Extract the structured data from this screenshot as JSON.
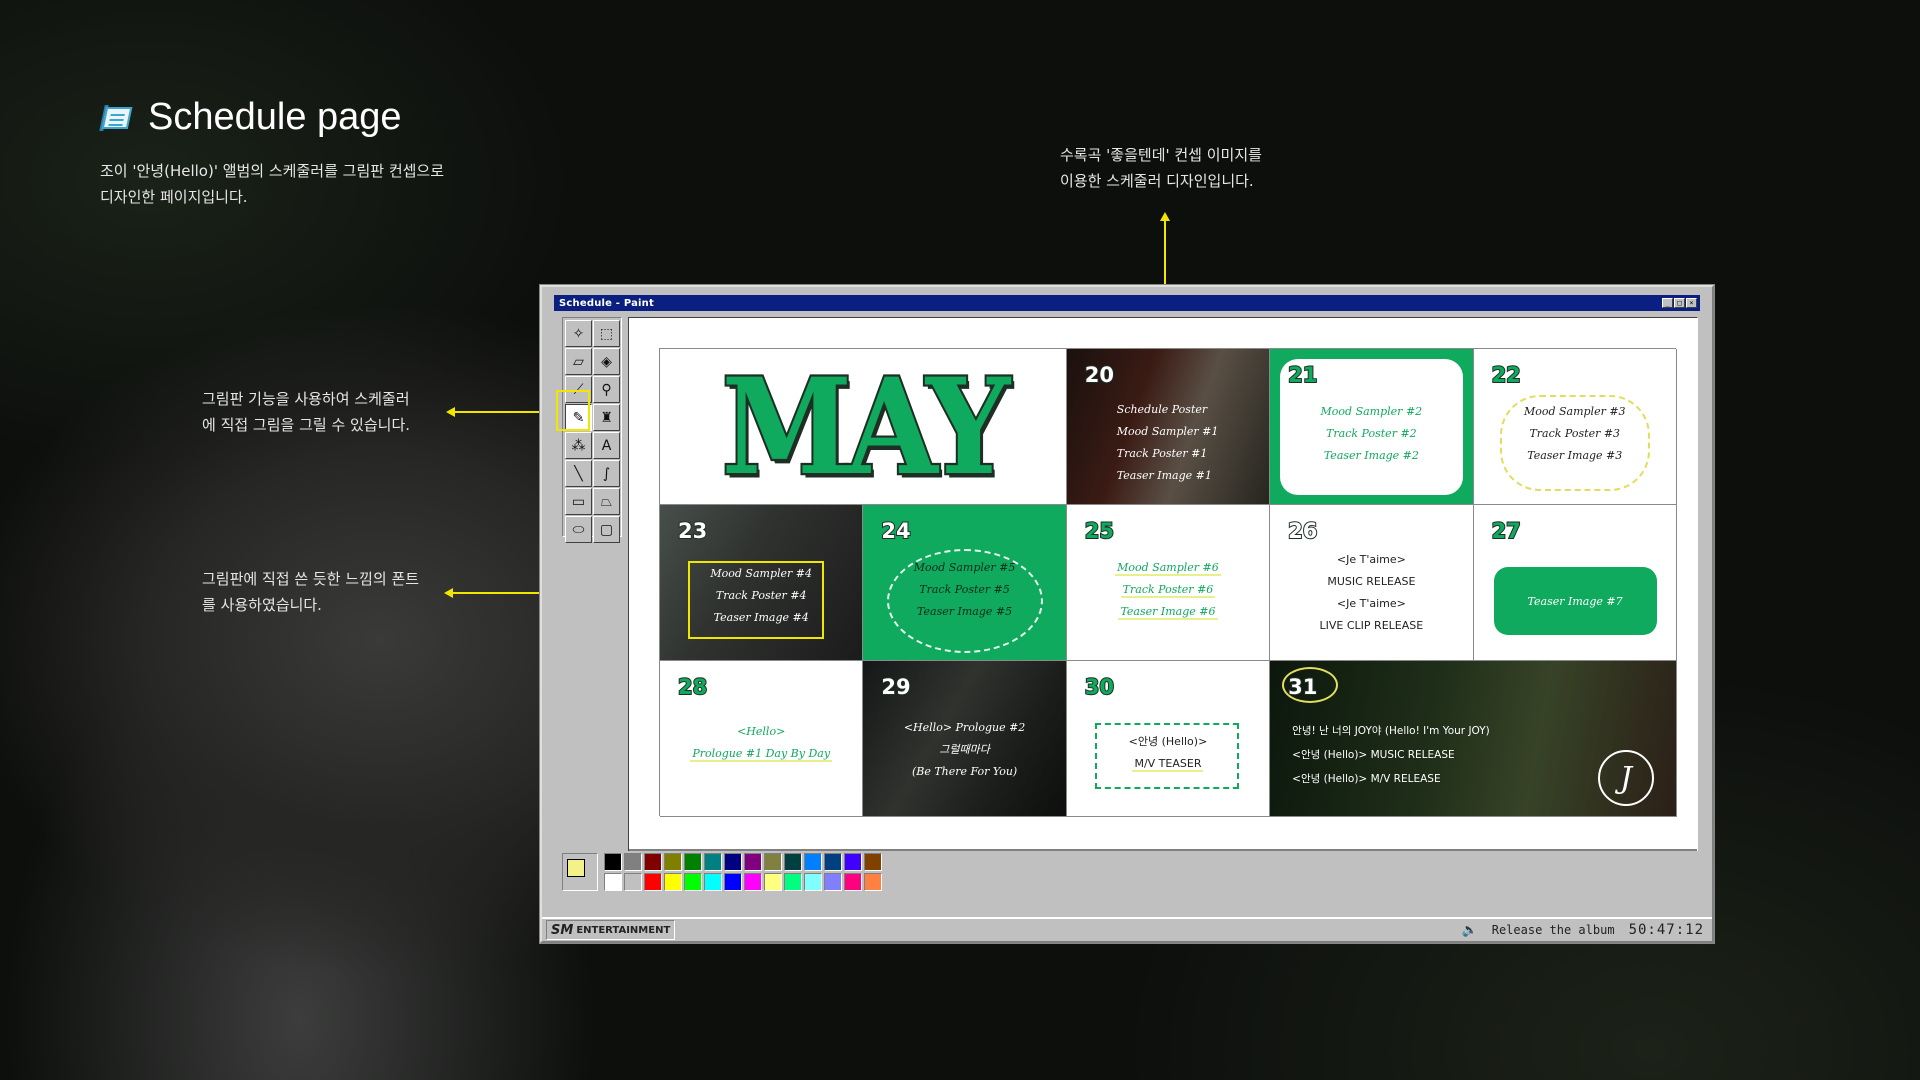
{
  "page": {
    "title": "Schedule page",
    "description_line1": "조이 '안녕(Hello)' 앨범의 스케줄러를 그림판 컨셉으로",
    "description_line2": "디자인한 페이지입니다."
  },
  "annotations": {
    "top_line1": "수록곡 '좋을텐데' 컨셉 이미지를",
    "top_line2": "이용한 스케줄러 디자인입니다.",
    "tool_line1": "그림판 기능을 사용하여 스케줄러",
    "tool_line2": "에 직접 그림을 그릴 수 있습니다.",
    "font_line1": "그림판에 직접 쓴 듯한 느낌의 폰트",
    "font_line2": "를 사용하였습니다."
  },
  "window": {
    "title": "Schedule - Paint",
    "min": "_",
    "max": "□",
    "close": "×"
  },
  "calendar": {
    "month": "MAY",
    "d20": {
      "num": "20",
      "l1": "Schedule Poster",
      "l2": "Mood Sampler #1",
      "l3": "Track Poster #1",
      "l4": "Teaser Image #1"
    },
    "d21": {
      "num": "21",
      "l1": "Mood Sampler #2",
      "l2": "Track Poster #2",
      "l3": "Teaser Image #2"
    },
    "d22": {
      "num": "22",
      "l1": "Mood Sampler #3",
      "l2": "Track Poster #3",
      "l3": "Teaser Image #3"
    },
    "d23": {
      "num": "23",
      "l1": "Mood Sampler #4",
      "l2": "Track Poster #4",
      "l3": "Teaser Image #4"
    },
    "d24": {
      "num": "24",
      "l1": "Mood Sampler #5",
      "l2": "Track Poster #5",
      "l3": "Teaser Image #5"
    },
    "d25": {
      "num": "25",
      "l1": "Mood Sampler #6",
      "l2": "Track Poster #6",
      "l3": "Teaser Image #6"
    },
    "d26": {
      "num": "26",
      "l1": "<Je T'aime>",
      "l2": "MUSIC RELEASE",
      "l3": "<Je T'aime>",
      "l4": "LIVE CLIP RELEASE"
    },
    "d27": {
      "num": "27",
      "l1": "Teaser Image #7"
    },
    "d28": {
      "num": "28",
      "l1": "<Hello>",
      "l2": "Prologue #1 Day By Day"
    },
    "d29": {
      "num": "29",
      "l1": "<Hello> Prologue #2",
      "l2": "그럴때마다",
      "l3": "(Be There For You)"
    },
    "d30": {
      "num": "30",
      "l1": "<안녕 (Hello)>",
      "l2": "M/V TEASER"
    },
    "d31": {
      "num": "31",
      "l1": "안녕! 난 너의 JOY야 (Hello! I'm Your JOY)",
      "l2": "<안녕 (Hello)> MUSIC RELEASE",
      "l3": "<안녕 (Hello)> M/V RELEASE",
      "logo": "J"
    }
  },
  "palette": {
    "top": [
      "#000000",
      "#808080",
      "#800000",
      "#808000",
      "#008000",
      "#008080",
      "#000080",
      "#800080",
      "#808040",
      "#004040",
      "#0080ff",
      "#004080",
      "#4000ff",
      "#804000"
    ],
    "bottom": [
      "#ffffff",
      "#c0c0c0",
      "#ff0000",
      "#ffff00",
      "#00ff00",
      "#00ffff",
      "#0000ff",
      "#ff00ff",
      "#ffff80",
      "#00ff80",
      "#80ffff",
      "#8080ff",
      "#ff0080",
      "#ff8040"
    ]
  },
  "taskbar": {
    "brand": "ENTERTAINMENT",
    "brand_mark": "SM",
    "status": "Release the album",
    "clock": "50:47:12"
  }
}
